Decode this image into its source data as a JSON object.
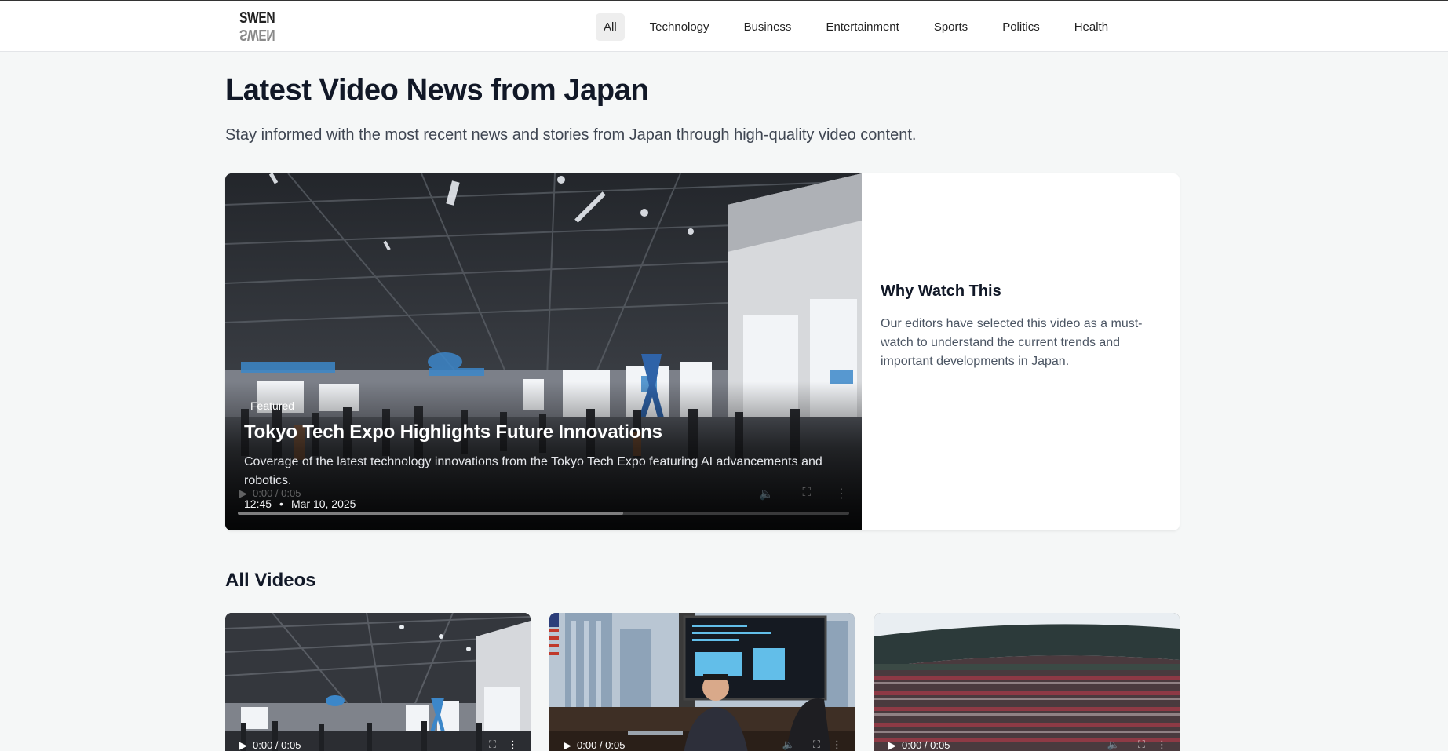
{
  "header": {
    "logo_text": "SWEN",
    "nav": [
      "All",
      "Technology",
      "Business",
      "Entertainment",
      "Sports",
      "Politics",
      "Health"
    ],
    "active_nav": "All"
  },
  "hero": {
    "title": "Latest Video News from Japan",
    "subtitle": "Stay informed with the most recent news and stories from Japan through high-quality video content."
  },
  "featured": {
    "badge": "Featured",
    "title": "Tokyo Tech Expo Highlights Future Innovations",
    "description": "Coverage of the latest technology innovations from the Tokyo Tech Expo featuring AI advancements and robotics.",
    "duration": "12:45",
    "separator": "•",
    "date": "Mar 10, 2025",
    "player_time": "0:00 / 0:05",
    "progress": 0.63
  },
  "why_watch": {
    "title": "Why Watch This",
    "text": "Our editors have selected this video as a must-watch to understand the current trends and important developments in Japan."
  },
  "all_videos": {
    "title": "All Videos",
    "cards": [
      {
        "player_time": "0:00 / 0:05",
        "thumb": "tech-expo-hall"
      },
      {
        "player_time": "0:00 / 0:05",
        "thumb": "business-office"
      },
      {
        "player_time": "0:00 / 0:05",
        "thumb": "stadium-crowd"
      }
    ]
  },
  "icons": {
    "play": "play-icon",
    "volume": "volume-icon",
    "fullscreen": "fullscreen-icon",
    "more": "more-vertical-icon"
  }
}
